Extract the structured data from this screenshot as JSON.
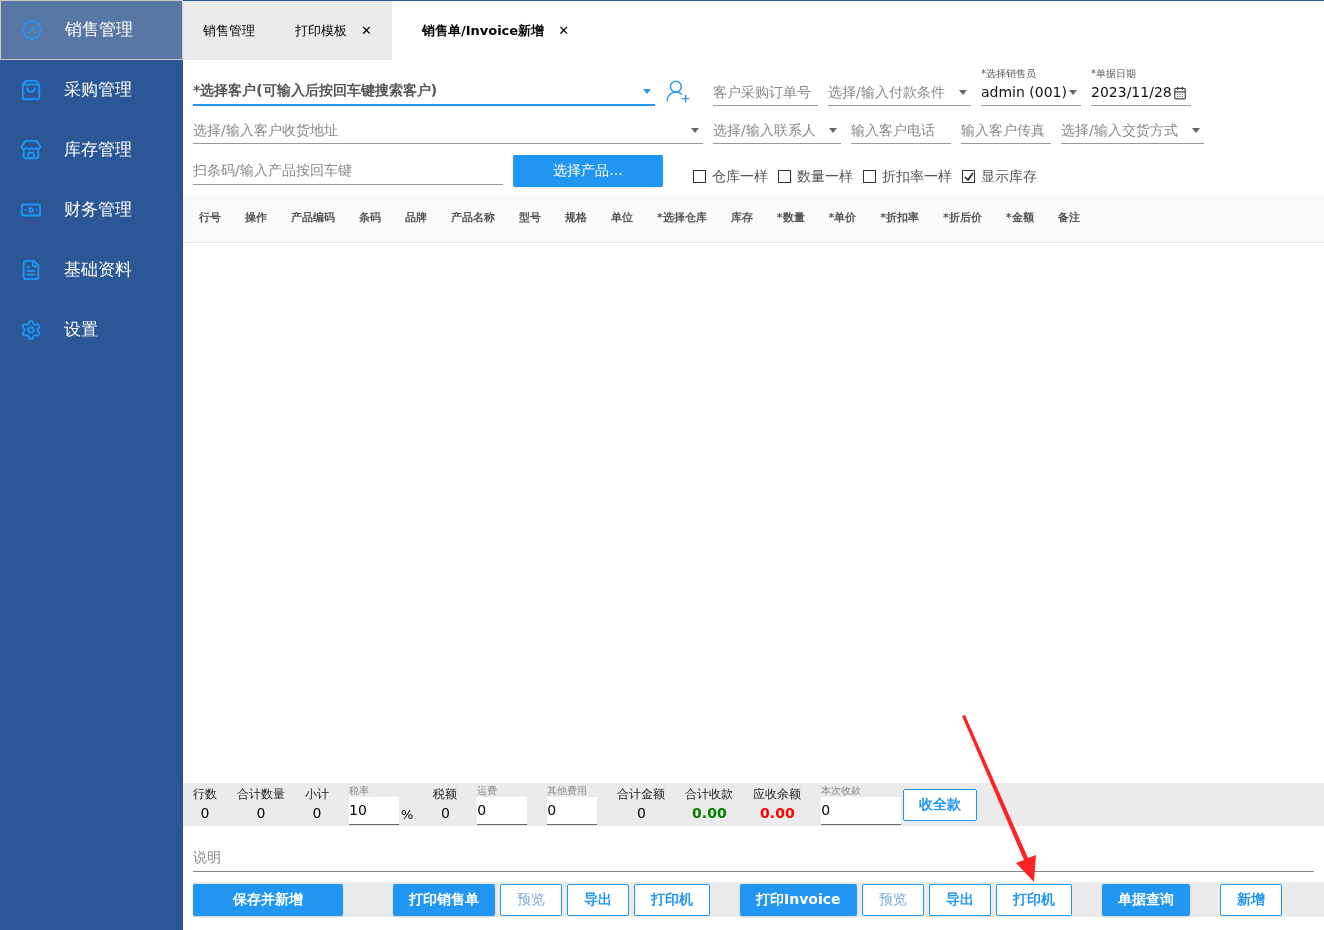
{
  "sidebar": {
    "items": [
      {
        "label": "销售管理",
        "kind": "sales",
        "selected": true
      },
      {
        "label": "采购管理",
        "kind": "purchase",
        "selected": false
      },
      {
        "label": "库存管理",
        "kind": "inventory",
        "selected": false
      },
      {
        "label": "财务管理",
        "kind": "finance",
        "selected": false
      },
      {
        "label": "基础资料",
        "kind": "docs",
        "selected": false
      },
      {
        "label": "设置",
        "kind": "settings",
        "selected": false
      }
    ]
  },
  "tabs": [
    {
      "label": "销售管理",
      "selected": false,
      "closable": false
    },
    {
      "label": "打印模板",
      "selected": false,
      "closable": true
    },
    {
      "label": "销售单/Invoice新增",
      "selected": true,
      "closable": true
    }
  ],
  "close_glyph": "✕",
  "form": {
    "customer": {
      "placeholder": "*选择客户(可输入后按回车键搜索客户)"
    },
    "po_number": {
      "placeholder": "客户采购订单号"
    },
    "payment_terms": {
      "placeholder": "选择/输入付款条件"
    },
    "salesperson": {
      "label": "*选择销售员",
      "value": "admin (001)"
    },
    "date": {
      "label": "*单据日期",
      "value": "2023/11/28"
    },
    "address": {
      "placeholder": "选择/输入客户收货地址"
    },
    "contact": {
      "placeholder": "选择/输入联系人"
    },
    "phone": {
      "placeholder": "输入客户电话"
    },
    "fax": {
      "placeholder": "输入客户传真"
    },
    "delivery": {
      "placeholder": "选择/输入交货方式"
    },
    "barcode": {
      "placeholder": "扫条码/输入产品按回车键"
    },
    "select_product_button": "选择产品...",
    "checkboxes": [
      {
        "label": "仓库一样",
        "checked": false
      },
      {
        "label": "数量一样",
        "checked": false
      },
      {
        "label": "折扣率一样",
        "checked": false
      },
      {
        "label": "显示库存",
        "checked": true
      }
    ]
  },
  "table": {
    "columns": [
      "行号",
      "操作",
      "产品编码",
      "条码",
      "品牌",
      "产品名称",
      "型号",
      "规格",
      "单位",
      "*选择仓库",
      "库存",
      "*数量",
      "*单价",
      "*折扣率",
      "*折后价",
      "*金额",
      "备注"
    ]
  },
  "summary": {
    "items": [
      {
        "kind": "stat",
        "label": "行数",
        "value": "0"
      },
      {
        "kind": "stat",
        "label": "合计数量",
        "value": "0"
      },
      {
        "kind": "stat",
        "label": "小计",
        "value": "0"
      },
      {
        "kind": "input",
        "label": "税率",
        "value": "10",
        "suffix": "%"
      },
      {
        "kind": "stat",
        "label": "税额",
        "value": "0"
      },
      {
        "kind": "input",
        "label": "运费",
        "value": "0"
      },
      {
        "kind": "input",
        "label": "其他费用",
        "value": "0"
      },
      {
        "kind": "stat",
        "label": "合计金额",
        "value": "0"
      },
      {
        "kind": "stat",
        "label": "合计收款",
        "value": "0.00",
        "color": "#008000"
      },
      {
        "kind": "stat",
        "label": "应收余额",
        "value": "0.00",
        "color": "#ff0000"
      },
      {
        "kind": "input",
        "label": "本次收款",
        "value": "0"
      }
    ],
    "pay_all_button": "收全款"
  },
  "note": {
    "placeholder": "说明"
  },
  "button_groups": [
    [
      {
        "label": "保存并新增",
        "kind": "primary"
      }
    ],
    [
      {
        "label": "打印销售单",
        "kind": "primary"
      },
      {
        "label": "预览",
        "kind": "outline",
        "muted": true
      },
      {
        "label": "导出",
        "kind": "outline",
        "muted": false
      },
      {
        "label": "打印机",
        "kind": "outline",
        "muted": false
      }
    ],
    [
      {
        "label": "打印Invoice",
        "kind": "primary"
      },
      {
        "label": "预览",
        "kind": "outline",
        "muted": true
      },
      {
        "label": "导出",
        "kind": "outline",
        "muted": false
      },
      {
        "label": "打印机",
        "kind": "outline",
        "muted": false
      }
    ],
    [
      {
        "label": "单据查询",
        "kind": "primary"
      }
    ],
    [
      {
        "label": "新增",
        "kind": "outline",
        "muted": false
      }
    ]
  ]
}
